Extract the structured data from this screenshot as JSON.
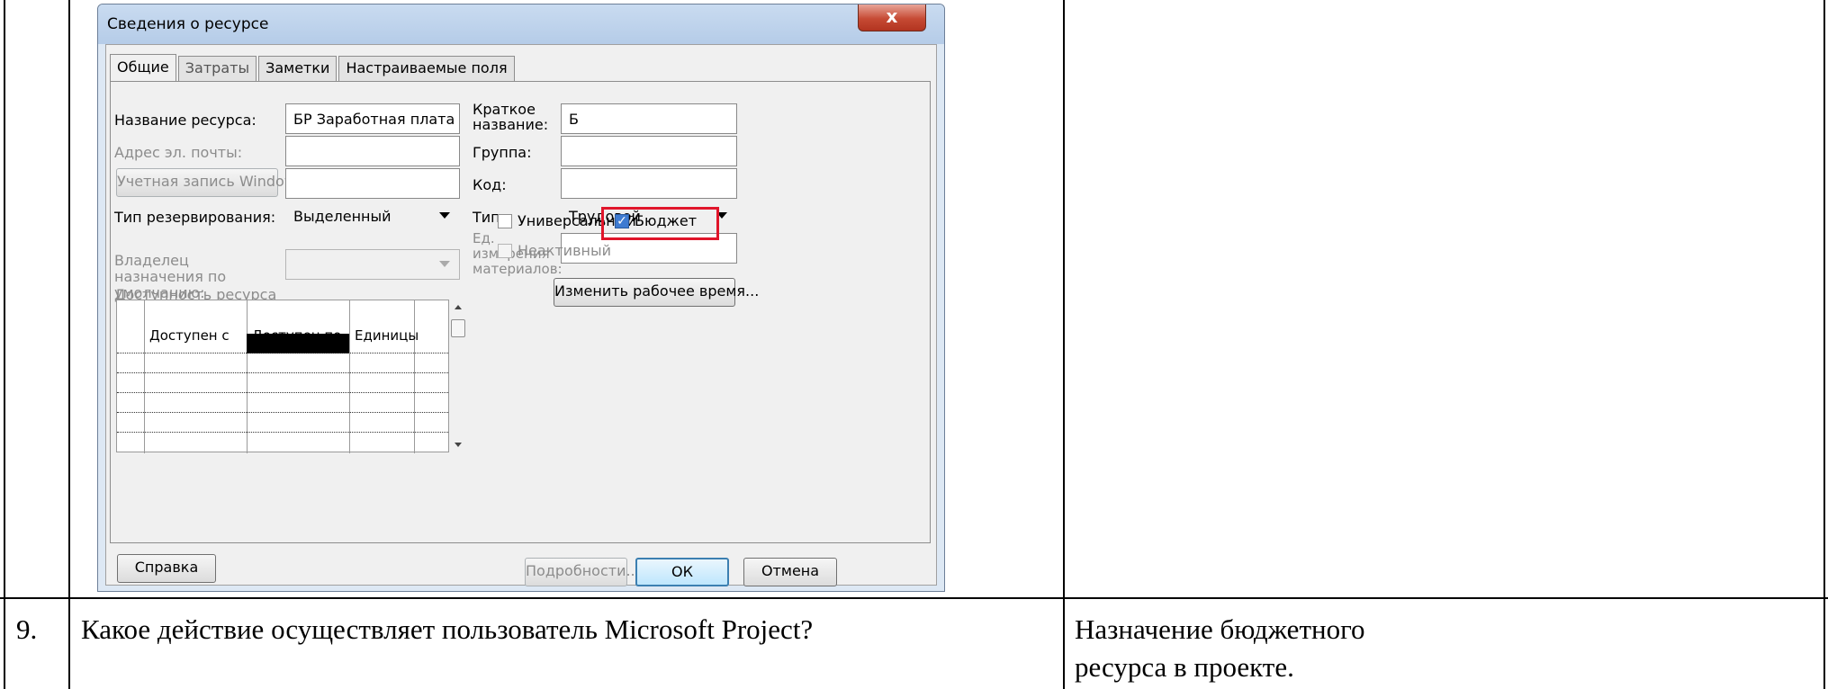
{
  "dialog": {
    "title": "Сведения о ресурсе",
    "close_glyph": "x",
    "tabs": [
      "Общие",
      "Затраты",
      "Заметки",
      "Настраиваемые поля"
    ],
    "labels": {
      "resource_name": "Название ресурса:",
      "email": "Адрес эл. почты:",
      "windows_account": "Учетная запись Windows...",
      "booking_type": "Тип резервирования:",
      "default_owner": "Владелец назначения по умолчанию:",
      "availability": "Доступность ресурса",
      "short_name": "Краткое название:",
      "group": "Группа:",
      "code": "Код:",
      "type": "Тип:",
      "material_unit": "Ед. измерения материалов:",
      "generic": "Универсальный",
      "budget": "Бюджет",
      "inactive": "Неактивный"
    },
    "values": {
      "resource_name": "БР Заработная плата ИТР",
      "email": "",
      "windows_account": "",
      "booking_type": "Выделенный",
      "default_owner": "",
      "short_name": "Б",
      "group": "",
      "code": "",
      "type": "Трудовой",
      "material_unit": "",
      "generic_checked": false,
      "budget_checked": true,
      "inactive_checked": false
    },
    "availability_grid": {
      "columns": [
        "Доступен с",
        "Доступен по",
        "Единицы"
      ],
      "rows": [
        [
          "",
          "",
          ""
        ],
        [
          "",
          "",
          ""
        ],
        [
          "",
          "",
          ""
        ],
        [
          "",
          "",
          ""
        ],
        [
          "",
          "",
          ""
        ],
        [
          "",
          "",
          ""
        ]
      ]
    },
    "buttons": {
      "change_working_time": "Изменить рабочее время...",
      "help": "Справка",
      "details": "Подробности...",
      "ok": "ОК",
      "cancel": "Отмена"
    }
  },
  "table": {
    "row_number": "9.",
    "question": "Какое действие осуществляет пользователь Microsoft Project?",
    "answer_line1": "Назначение бюджетного",
    "answer_line2": "ресурса в проекте."
  }
}
